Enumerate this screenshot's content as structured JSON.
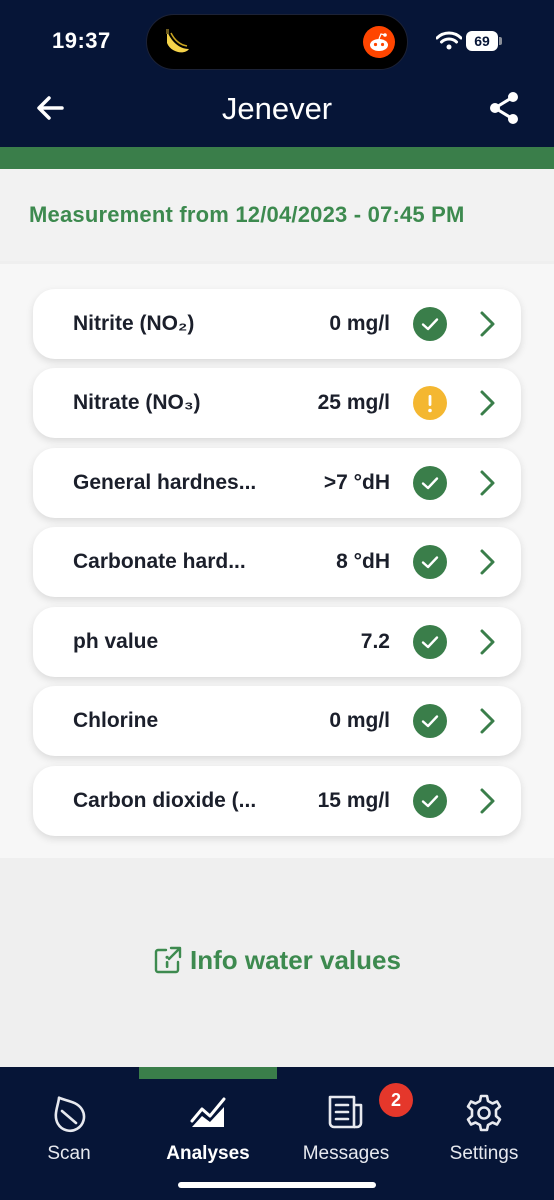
{
  "status_bar": {
    "time": "19:37",
    "battery": "69"
  },
  "header": {
    "title": "Jenever",
    "back_icon": "arrow-left-icon",
    "share_icon": "share-icon"
  },
  "measurement": {
    "label": "Measurement from 12/04/2023 - 07:45 PM"
  },
  "rows": [
    {
      "label": "Nitrite (NO₂)",
      "value": "0 mg/l",
      "status": "ok"
    },
    {
      "label": "Nitrate (NO₃)",
      "value": "25 mg/l",
      "status": "warn"
    },
    {
      "label": "General hardnes...",
      "value": ">7 °dH",
      "status": "ok"
    },
    {
      "label": "Carbonate hard...",
      "value": "8 °dH",
      "status": "ok"
    },
    {
      "label": "ph value",
      "value": "7.2",
      "status": "ok"
    },
    {
      "label": "Chlorine",
      "value": "0 mg/l",
      "status": "ok"
    },
    {
      "label": "Carbon dioxide (...",
      "value": "15 mg/l",
      "status": "ok"
    }
  ],
  "info_link": {
    "label": "Info water values",
    "icon": "external-info-icon"
  },
  "tabs": [
    {
      "label": "Scan",
      "icon": "drop-scan-icon",
      "active": false
    },
    {
      "label": "Analyses",
      "icon": "chart-icon",
      "active": true
    },
    {
      "label": "Messages",
      "icon": "messages-icon",
      "active": false,
      "badge": "2"
    },
    {
      "label": "Settings",
      "icon": "gear-icon",
      "active": false
    }
  ],
  "colors": {
    "navy": "#061537",
    "green": "#3a7e4a",
    "warning": "#f4b731",
    "badge": "#e5372b"
  }
}
